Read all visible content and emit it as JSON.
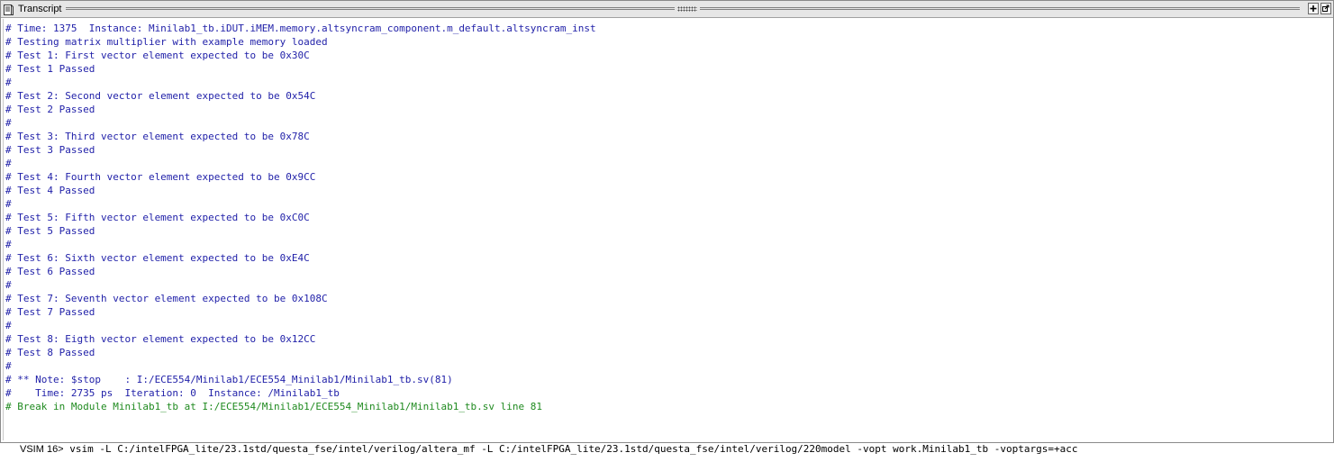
{
  "window": {
    "title": "Transcript"
  },
  "transcript": {
    "lines": [
      {
        "text": "# Time: 1375  Instance: Minilab1_tb.iDUT.iMEM.memory.altsyncram_component.m_default.altsyncram_inst",
        "color": "#1f1fa8"
      },
      {
        "text": "# Testing matrix multiplier with example memory loaded",
        "color": "#1f1fa8"
      },
      {
        "text": "# Test 1: First vector element expected to be 0x30C",
        "color": "#1f1fa8"
      },
      {
        "text": "# Test 1 Passed",
        "color": "#1f1fa8"
      },
      {
        "text": "#",
        "color": "#1f1fa8"
      },
      {
        "text": "# Test 2: Second vector element expected to be 0x54C",
        "color": "#1f1fa8"
      },
      {
        "text": "# Test 2 Passed",
        "color": "#1f1fa8"
      },
      {
        "text": "#",
        "color": "#1f1fa8"
      },
      {
        "text": "# Test 3: Third vector element expected to be 0x78C",
        "color": "#1f1fa8"
      },
      {
        "text": "# Test 3 Passed",
        "color": "#1f1fa8"
      },
      {
        "text": "#",
        "color": "#1f1fa8"
      },
      {
        "text": "# Test 4: Fourth vector element expected to be 0x9CC",
        "color": "#1f1fa8"
      },
      {
        "text": "# Test 4 Passed",
        "color": "#1f1fa8"
      },
      {
        "text": "#",
        "color": "#1f1fa8"
      },
      {
        "text": "# Test 5: Fifth vector element expected to be 0xC0C",
        "color": "#1f1fa8"
      },
      {
        "text": "# Test 5 Passed",
        "color": "#1f1fa8"
      },
      {
        "text": "#",
        "color": "#1f1fa8"
      },
      {
        "text": "# Test 6: Sixth vector element expected to be 0xE4C",
        "color": "#1f1fa8"
      },
      {
        "text": "# Test 6 Passed",
        "color": "#1f1fa8"
      },
      {
        "text": "#",
        "color": "#1f1fa8"
      },
      {
        "text": "# Test 7: Seventh vector element expected to be 0x108C",
        "color": "#1f1fa8"
      },
      {
        "text": "# Test 7 Passed",
        "color": "#1f1fa8"
      },
      {
        "text": "#",
        "color": "#1f1fa8"
      },
      {
        "text": "# Test 8: Eigth vector element expected to be 0x12CC",
        "color": "#1f1fa8"
      },
      {
        "text": "# Test 8 Passed",
        "color": "#1f1fa8"
      },
      {
        "text": "#",
        "color": "#1f1fa8"
      },
      {
        "text": "# ** Note: $stop    : I:/ECE554/Minilab1/ECE554_Minilab1/Minilab1_tb.sv(81)",
        "color": "#1f1fa8"
      },
      {
        "text": "#    Time: 2735 ps  Iteration: 0  Instance: /Minilab1_tb",
        "color": "#1f1fa8"
      },
      {
        "text": "# Break in Module Minilab1_tb at I:/ECE554/Minilab1/ECE554_Minilab1/Minilab1_tb.sv line 81",
        "color": "#1f8a1f"
      }
    ]
  },
  "prompt": {
    "label": "VSIM 16>",
    "command": " vsim -L C:/intelFPGA_lite/23.1std/questa_fse/intel/verilog/altera_mf -L C:/intelFPGA_lite/23.1std/questa_fse/intel/verilog/220model -vopt work.Minilab1_tb -voptargs=+acc"
  },
  "icons": {
    "title": "transcript-icon",
    "maximize": "plus-icon",
    "undock": "undock-icon"
  }
}
